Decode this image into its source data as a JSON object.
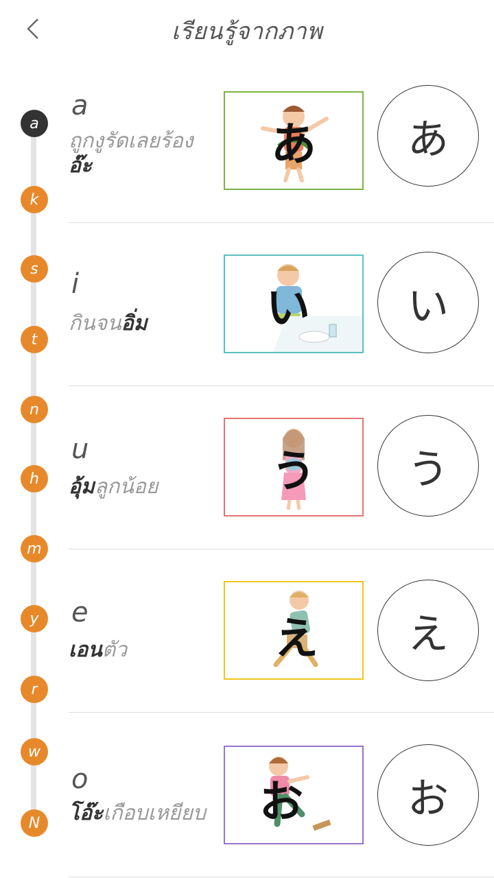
{
  "header": {
    "title": "เรียนรู้จากภาพ",
    "back_icon": "chevron-left-icon"
  },
  "index": [
    "a",
    "k",
    "s",
    "t",
    "n",
    "h",
    "m",
    "y",
    "r",
    "w",
    "N"
  ],
  "colors": {
    "accent": "#e7892b",
    "active": "#333333",
    "frame_a": "#7cb342",
    "frame_i": "#5bc0be",
    "frame_u": "#e57373",
    "frame_e": "#f0c419",
    "frame_o": "#9575cd"
  },
  "rows": [
    {
      "romaji": "a",
      "desc_plain": "ถูกงูรัดเลยร้อง",
      "desc_bold": "อ๊ะ",
      "kana": "あ"
    },
    {
      "romaji": "i",
      "desc_plain": "กินจน",
      "desc_bold": "อิ่ม",
      "kana": "い"
    },
    {
      "romaji": "u",
      "desc_bold": "อุ้ม",
      "desc_plain": "ลูกน้อย",
      "kana": "う"
    },
    {
      "romaji": "e",
      "desc_bold": "เอน",
      "desc_plain": "ตัว",
      "kana": "え"
    },
    {
      "romaji": "o",
      "desc_bold": "โอ๊ะ",
      "desc_plain": "เกือบเหยียบ",
      "kana": "お"
    }
  ]
}
